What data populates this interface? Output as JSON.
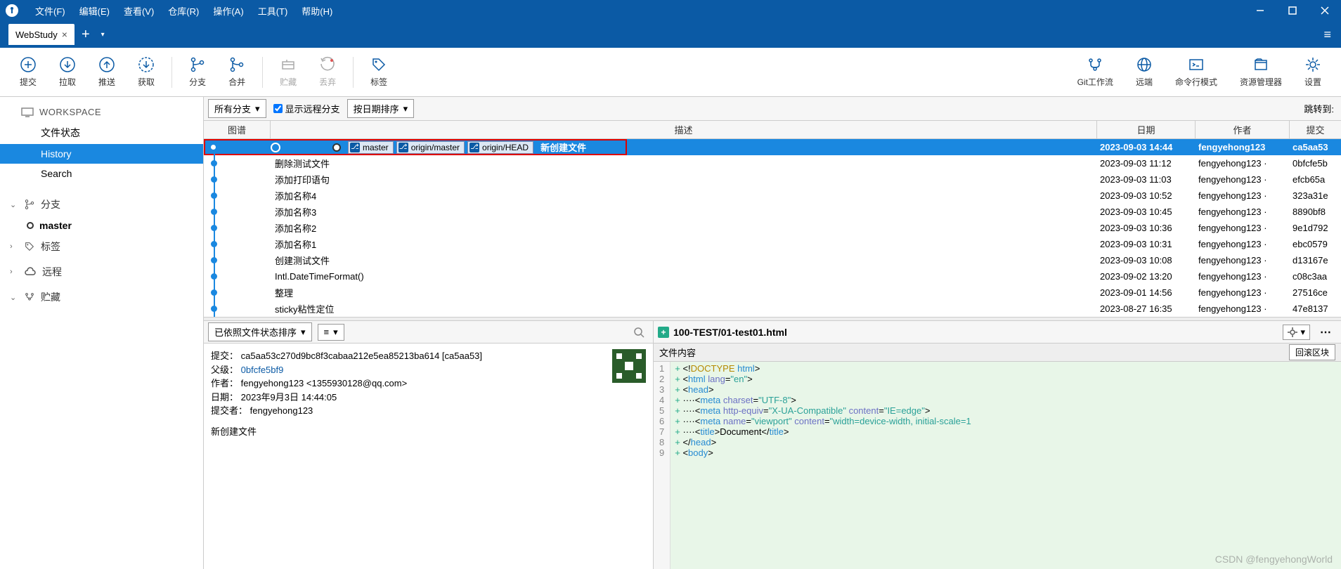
{
  "menus": [
    "文件(F)",
    "编辑(E)",
    "查看(V)",
    "仓库(R)",
    "操作(A)",
    "工具(T)",
    "帮助(H)"
  ],
  "tab": {
    "name": "WebStudy"
  },
  "toolbar": {
    "left": [
      {
        "key": "commit",
        "label": "提交"
      },
      {
        "key": "pull",
        "label": "拉取"
      },
      {
        "key": "push",
        "label": "推送"
      },
      {
        "key": "fetch",
        "label": "获取"
      },
      {
        "key": "branch",
        "label": "分支"
      },
      {
        "key": "merge",
        "label": "合并"
      },
      {
        "key": "stash",
        "label": "贮藏",
        "disabled": true
      },
      {
        "key": "discard",
        "label": "丢弃",
        "disabled": true
      },
      {
        "key": "tag",
        "label": "标签"
      }
    ],
    "right": [
      {
        "key": "gitflow",
        "label": "Git工作流"
      },
      {
        "key": "remote",
        "label": "远端"
      },
      {
        "key": "cmd",
        "label": "命令行模式"
      },
      {
        "key": "explorer",
        "label": "资源管理器"
      },
      {
        "key": "settings",
        "label": "设置"
      }
    ]
  },
  "sidebar": {
    "workspace": "WORKSPACE",
    "items": [
      "文件状态",
      "History",
      "Search"
    ],
    "groups": [
      {
        "label": "分支",
        "icon": "branch",
        "expanded": true,
        "children": [
          "master"
        ]
      },
      {
        "label": "标签",
        "icon": "tag",
        "expanded": false
      },
      {
        "label": "远程",
        "icon": "cloud",
        "expanded": false
      },
      {
        "label": "贮藏",
        "icon": "stash",
        "expanded": true
      }
    ]
  },
  "filter": {
    "allBranches": "所有分支",
    "showRemote": "显示远程分支",
    "sortDate": "按日期排序",
    "jump": "跳转到:"
  },
  "gridHeaders": {
    "graph": "图谱",
    "desc": "描述",
    "date": "日期",
    "author": "作者",
    "commit": "提交"
  },
  "commits": [
    {
      "branches": [
        "master",
        "origin/master",
        "origin/HEAD"
      ],
      "msg": "新创建文件",
      "date": "2023-09-03 14:44",
      "author": "fengyehong123",
      "sha": "ca5aa53",
      "selected": true,
      "head": true
    },
    {
      "msg": "删除测试文件",
      "date": "2023-09-03 11:12",
      "author": "fengyehong123 ·",
      "sha": "0bfcfe5b"
    },
    {
      "msg": "添加打印语句",
      "date": "2023-09-03 11:03",
      "author": "fengyehong123 ·",
      "sha": "efcb65a"
    },
    {
      "msg": "添加名称4",
      "date": "2023-09-03 10:52",
      "author": "fengyehong123 ·",
      "sha": "323a31e"
    },
    {
      "msg": "添加名称3",
      "date": "2023-09-03 10:45",
      "author": "fengyehong123 ·",
      "sha": "8890bf8"
    },
    {
      "msg": "添加名称2",
      "date": "2023-09-03 10:36",
      "author": "fengyehong123 ·",
      "sha": "9e1d792"
    },
    {
      "msg": "添加名称1",
      "date": "2023-09-03 10:31",
      "author": "fengyehong123 ·",
      "sha": "ebc0579"
    },
    {
      "msg": "创建测试文件",
      "date": "2023-09-03 10:08",
      "author": "fengyehong123 ·",
      "sha": "d13167e"
    },
    {
      "msg": "Intl.DateTimeFormat()",
      "date": "2023-09-02 13:20",
      "author": "fengyehong123 ·",
      "sha": "c08c3aa"
    },
    {
      "msg": "整理",
      "date": "2023-09-01 14:56",
      "author": "fengyehong123 ·",
      "sha": "27516ce"
    },
    {
      "msg": "sticky粘性定位",
      "date": "2023-08-27 16:35",
      "author": "fengyehong123 ·",
      "sha": "47e8137"
    }
  ],
  "fileSort": {
    "label": "已依照文件状态排序",
    "view": "≡"
  },
  "detail": {
    "commitLabel": "提交：",
    "commitVal": "ca5aa53c270d9bc8f3cabaa212e5ea85213ba614 [ca5aa53]",
    "parentLabel": "父级：",
    "parentVal": "0bfcfe5bf9",
    "authorLabel": "作者：",
    "authorVal": "fengyehong123 <1355930128@qq.com>",
    "dateLabel": "日期：",
    "dateVal": "2023年9月3日 14:44:05",
    "committerLabel": "提交者：",
    "committerVal": "fengyehong123",
    "message": "新创建文件"
  },
  "diff": {
    "filename": "100-TEST/01-test01.html",
    "subheader": "文件内容",
    "rollback": "回滚区块",
    "lines": [
      {
        "n": 1,
        "html": "<span class='plus'>+</span> &lt;!<span class='doctype'>DOCTYPE</span> <span class='tag'>html</span>&gt;"
      },
      {
        "n": 2,
        "html": "<span class='plus'>+</span> &lt;<span class='tag'>html</span> <span class='attr'>lang</span>=<span class='str'>\"en\"</span>&gt;"
      },
      {
        "n": 3,
        "html": "<span class='plus'>+</span> &lt;<span class='tag'>head</span>&gt;"
      },
      {
        "n": 4,
        "html": "<span class='plus'>+</span> ····&lt;<span class='tag'>meta</span> <span class='attr'>charset</span>=<span class='str'>\"UTF-8\"</span>&gt;"
      },
      {
        "n": 5,
        "html": "<span class='plus'>+</span> ····&lt;<span class='tag'>meta</span> <span class='attr'>http-equiv</span>=<span class='str'>\"X-UA-Compatible\"</span> <span class='attr'>content</span>=<span class='str'>\"IE=edge\"</span>&gt;"
      },
      {
        "n": 6,
        "html": "<span class='plus'>+</span> ····&lt;<span class='tag'>meta</span> <span class='attr'>name</span>=<span class='str'>\"viewport\"</span> <span class='attr'>content</span>=<span class='str'>\"width=device-width, initial-scale=1"
      },
      {
        "n": 7,
        "html": "<span class='plus'>+</span> ····&lt;<span class='tag'>title</span>&gt;Document&lt;/<span class='tag'>title</span>&gt;"
      },
      {
        "n": 8,
        "html": "<span class='plus'>+</span> &lt;/<span class='tag'>head</span>&gt;"
      },
      {
        "n": 9,
        "html": "<span class='plus'>+</span> &lt;<span class='tag'>body</span>&gt;"
      }
    ]
  },
  "watermark": "CSDN @fengyehongWorld"
}
